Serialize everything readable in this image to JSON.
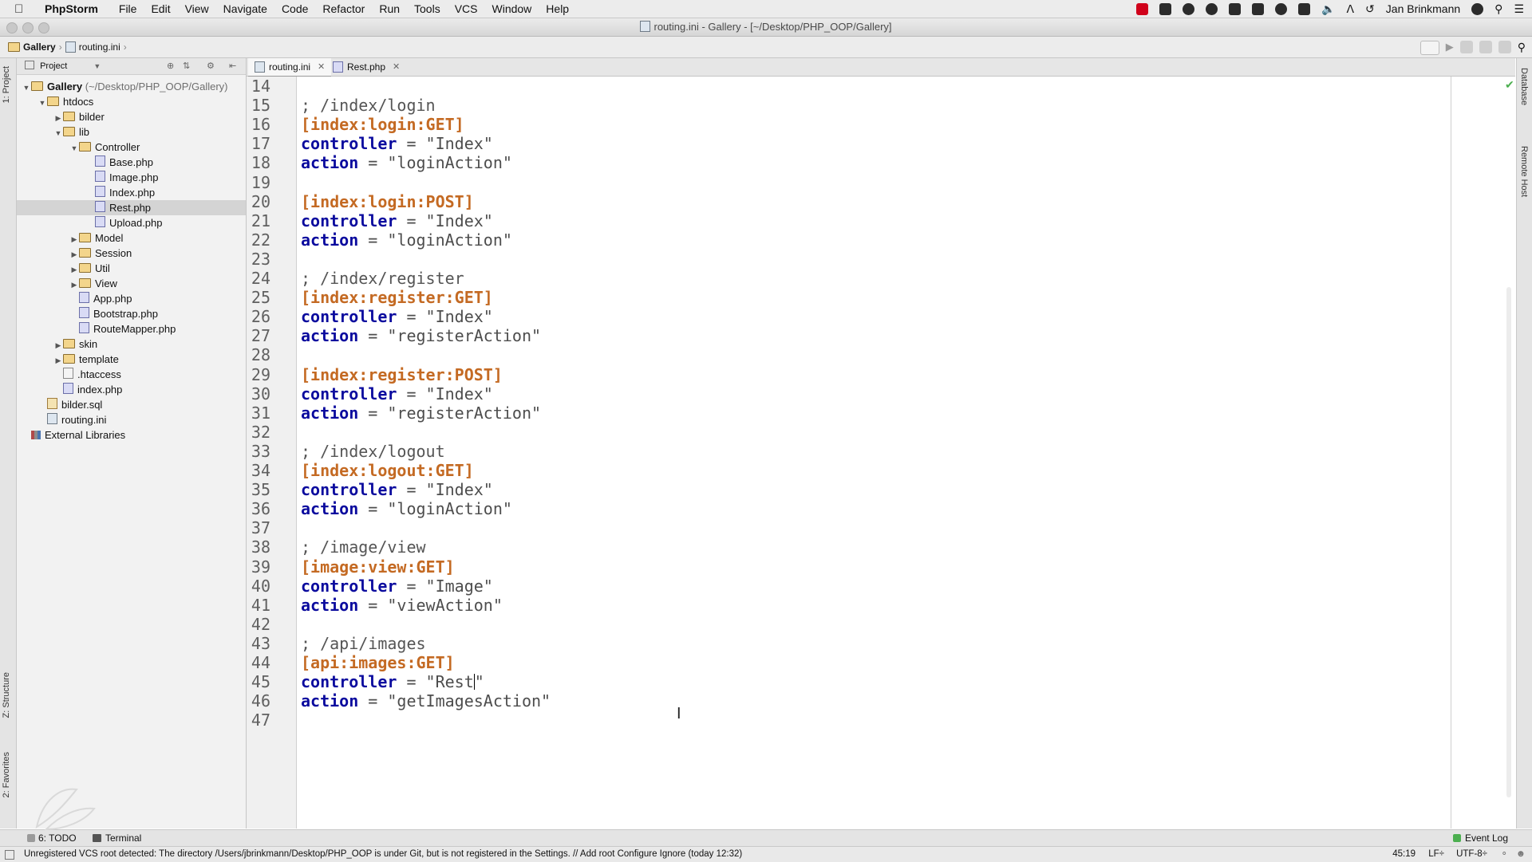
{
  "menubar": {
    "app_name": "PhpStorm",
    "items": [
      "File",
      "Edit",
      "View",
      "Navigate",
      "Code",
      "Refactor",
      "Run",
      "Tools",
      "VCS",
      "Window",
      "Help"
    ],
    "user": "Jan Brinkmann"
  },
  "window": {
    "title": "routing.ini - Gallery - [~/Desktop/PHP_OOP/Gallery]"
  },
  "navbar": {
    "breadcrumb": [
      "Gallery",
      "routing.ini"
    ]
  },
  "project_panel": {
    "header": "Project",
    "tree": [
      {
        "label": "Gallery",
        "path": "(~/Desktop/PHP_OOP/Gallery)",
        "type": "folder",
        "depth": 0,
        "expanded": true,
        "bold": true
      },
      {
        "label": "htdocs",
        "type": "folder",
        "depth": 1,
        "expanded": true
      },
      {
        "label": "bilder",
        "type": "folder",
        "depth": 2,
        "expanded": false
      },
      {
        "label": "lib",
        "type": "folder",
        "depth": 2,
        "expanded": true
      },
      {
        "label": "Controller",
        "type": "folder",
        "depth": 3,
        "expanded": true
      },
      {
        "label": "Base.php",
        "type": "php",
        "depth": 4
      },
      {
        "label": "Image.php",
        "type": "php",
        "depth": 4
      },
      {
        "label": "Index.php",
        "type": "php",
        "depth": 4
      },
      {
        "label": "Rest.php",
        "type": "php",
        "depth": 4,
        "selected": true
      },
      {
        "label": "Upload.php",
        "type": "php",
        "depth": 4
      },
      {
        "label": "Model",
        "type": "folder",
        "depth": 3,
        "expanded": false
      },
      {
        "label": "Session",
        "type": "folder",
        "depth": 3,
        "expanded": false
      },
      {
        "label": "Util",
        "type": "folder",
        "depth": 3,
        "expanded": false
      },
      {
        "label": "View",
        "type": "folder",
        "depth": 3,
        "expanded": false
      },
      {
        "label": "App.php",
        "type": "php",
        "depth": 3
      },
      {
        "label": "Bootstrap.php",
        "type": "php",
        "depth": 3
      },
      {
        "label": "RouteMapper.php",
        "type": "php",
        "depth": 3
      },
      {
        "label": "skin",
        "type": "folder",
        "depth": 2,
        "expanded": false
      },
      {
        "label": "template",
        "type": "folder",
        "depth": 2,
        "expanded": false
      },
      {
        "label": ".htaccess",
        "type": "file",
        "depth": 2
      },
      {
        "label": "index.php",
        "type": "php",
        "depth": 2
      },
      {
        "label": "bilder.sql",
        "type": "sql",
        "depth": 1
      },
      {
        "label": "routing.ini",
        "type": "ini",
        "depth": 1
      },
      {
        "label": "External Libraries",
        "type": "lib",
        "depth": 0
      }
    ]
  },
  "tabs": [
    {
      "label": "routing.ini",
      "icon": "ini-file-icon",
      "active": true
    },
    {
      "label": "Rest.php",
      "icon": "php-file-icon",
      "active": false
    }
  ],
  "editor": {
    "lines": [
      {
        "n": "14",
        "t": ""
      },
      {
        "n": "15",
        "t": "comment",
        "text": "; /index/login"
      },
      {
        "n": "16",
        "t": "section",
        "text": "[index:login:GET]"
      },
      {
        "n": "17",
        "t": "kv",
        "key": "controller",
        "value": "\"Index\""
      },
      {
        "n": "18",
        "t": "kv",
        "key": "action",
        "value": "\"loginAction\""
      },
      {
        "n": "19",
        "t": ""
      },
      {
        "n": "20",
        "t": "section",
        "text": "[index:login:POST]"
      },
      {
        "n": "21",
        "t": "kv",
        "key": "controller",
        "value": "\"Index\""
      },
      {
        "n": "22",
        "t": "kv",
        "key": "action",
        "value": "\"loginAction\""
      },
      {
        "n": "23",
        "t": ""
      },
      {
        "n": "24",
        "t": "comment",
        "text": "; /index/register"
      },
      {
        "n": "25",
        "t": "section",
        "text": "[index:register:GET]"
      },
      {
        "n": "26",
        "t": "kv",
        "key": "controller",
        "value": "\"Index\""
      },
      {
        "n": "27",
        "t": "kv",
        "key": "action",
        "value": "\"registerAction\""
      },
      {
        "n": "28",
        "t": ""
      },
      {
        "n": "29",
        "t": "section",
        "text": "[index:register:POST]"
      },
      {
        "n": "30",
        "t": "kv",
        "key": "controller",
        "value": "\"Index\""
      },
      {
        "n": "31",
        "t": "kv",
        "key": "action",
        "value": "\"registerAction\""
      },
      {
        "n": "32",
        "t": ""
      },
      {
        "n": "33",
        "t": "comment",
        "text": "; /index/logout"
      },
      {
        "n": "34",
        "t": "section",
        "text": "[index:logout:GET]"
      },
      {
        "n": "35",
        "t": "kv",
        "key": "controller",
        "value": "\"Index\""
      },
      {
        "n": "36",
        "t": "kv",
        "key": "action",
        "value": "\"loginAction\""
      },
      {
        "n": "37",
        "t": ""
      },
      {
        "n": "38",
        "t": "comment",
        "text": "; /image/view"
      },
      {
        "n": "39",
        "t": "section",
        "text": "[image:view:GET]"
      },
      {
        "n": "40",
        "t": "kv",
        "key": "controller",
        "value": "\"Image\""
      },
      {
        "n": "41",
        "t": "kv",
        "key": "action",
        "value": "\"viewAction\""
      },
      {
        "n": "42",
        "t": ""
      },
      {
        "n": "43",
        "t": "comment",
        "text": "; /api/images"
      },
      {
        "n": "44",
        "t": "section",
        "text": "[api:images:GET]"
      },
      {
        "n": "45",
        "t": "kv",
        "key": "controller",
        "value": "\"Rest",
        "caret": true,
        "after": "\""
      },
      {
        "n": "46",
        "t": "kv",
        "key": "action",
        "value": "\"getImagesAction\""
      },
      {
        "n": "47",
        "t": ""
      }
    ]
  },
  "side_tools": {
    "left": [
      "1: Project",
      "Z: Structure",
      "2: Favorites"
    ],
    "right": [
      "Database",
      "Remote Host"
    ]
  },
  "bottom_tools": {
    "todo": "6: TODO",
    "terminal": "Terminal",
    "event_log": "Event Log"
  },
  "status": {
    "message": "Unregistered VCS root detected: The directory /Users/jbrinkmann/Desktop/PHP_OOP is under Git, but is not registered in the Settings. // Add root  Configure  Ignore (today 12:32)",
    "position": "45:19",
    "line_sep": "LF÷",
    "encoding": "UTF-8÷"
  }
}
